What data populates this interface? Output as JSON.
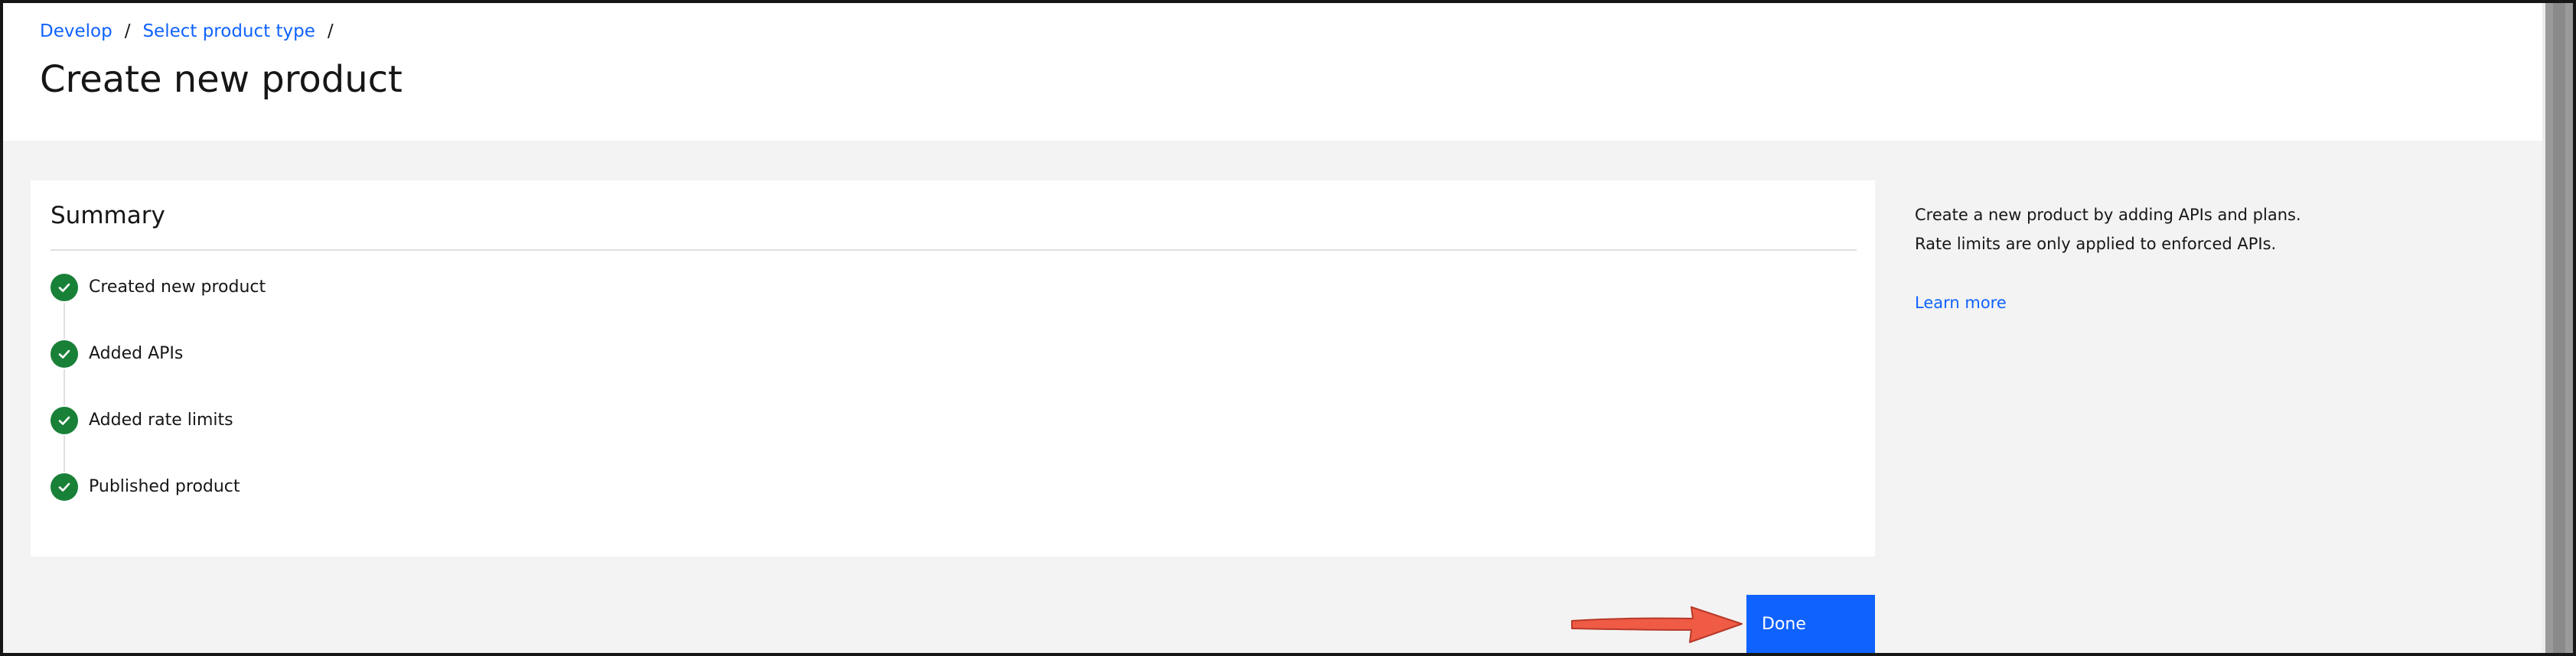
{
  "breadcrumb": {
    "items": [
      "Develop",
      "Select product type"
    ],
    "separator": "/"
  },
  "page": {
    "title": "Create new product"
  },
  "summary": {
    "title": "Summary",
    "steps": [
      {
        "label": "Created new product",
        "status": "complete"
      },
      {
        "label": "Added APIs",
        "status": "complete"
      },
      {
        "label": "Added rate limits",
        "status": "complete"
      },
      {
        "label": "Published product",
        "status": "complete"
      }
    ]
  },
  "side_panel": {
    "lines": [
      "Create a new product by adding APIs and plans.",
      "Rate limits are only applied to enforced APIs."
    ],
    "learn_more": "Learn more"
  },
  "actions": {
    "done_label": "Done"
  },
  "icons": {
    "step_complete": "checkmark-filled-icon",
    "annotation": "red-arrow-icon"
  },
  "colors": {
    "link": "#0f62fe",
    "primary_button": "#0f62fe",
    "success": "#198038",
    "annotation_arrow": "#ef5b45",
    "page_background": "#f3f3f3"
  }
}
